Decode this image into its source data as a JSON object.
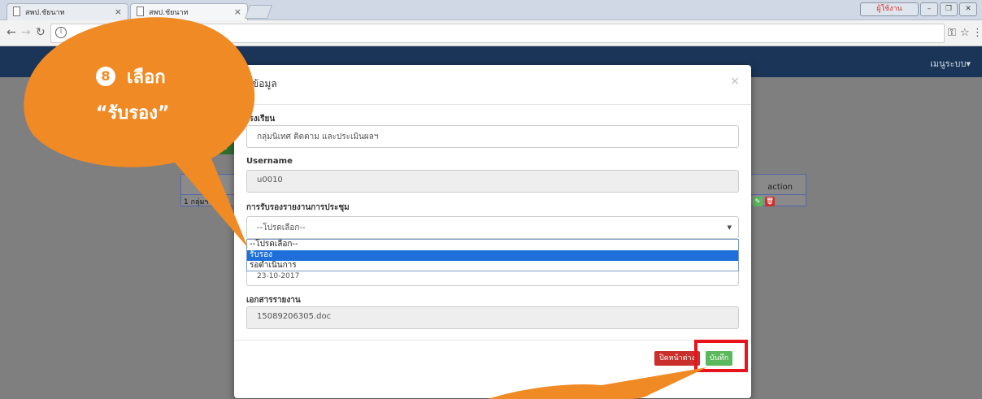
{
  "browser": {
    "tabs": [
      {
        "title": "สพป.ชัยนาท"
      },
      {
        "title": "สพป.ชัยนาท"
      }
    ],
    "user_button": "ผู้ใช้งาน"
  },
  "site": {
    "menu_label": "เมนูระบบ▾"
  },
  "background_table": {
    "action_header": "action",
    "row_text": "1 กลุ่มฯ"
  },
  "modal": {
    "title": "ข้อมูล",
    "close_symbol": "×",
    "fields": {
      "school_label": "เรงเรียน",
      "school_value": "กลุ่มนิเทศ ติดตาม และประเมินผลฯ",
      "username_label": "Username",
      "username_value": "u0010",
      "approval_label": "การรับรองรายงานการประชุม",
      "approval_selected": "--โปรดเลือก--",
      "date_value": "23-10-2017",
      "document_label": "เอกสารรายงาน",
      "document_value": "15089206305.doc"
    },
    "dropdown_options": [
      "--โปรดเลือก--",
      "รับรอง",
      "รอดำเนินการ"
    ],
    "dropdown_highlighted_index": 1,
    "buttons": {
      "close_window": "ปิดหน้าต่าง",
      "save": "บันทึก"
    }
  },
  "callout": {
    "step_number": "8",
    "line1": "เลือก",
    "line2": "“รับรอง”",
    "color": "#f08a24"
  },
  "colors": {
    "navbar": "#1a3557",
    "highlight_option": "#1e6fd9",
    "save_button": "#5cb85c",
    "close_button": "#c9302c",
    "annotation_box": "#e8141c"
  }
}
